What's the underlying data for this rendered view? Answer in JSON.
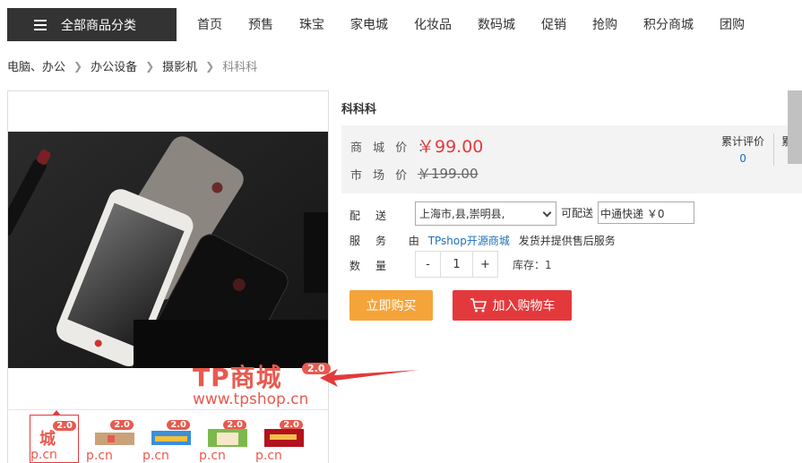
{
  "nav": {
    "category_button": "全部商品分类",
    "items": [
      "首页",
      "预售",
      "珠宝",
      "家电城",
      "化妆品",
      "数码城",
      "促销",
      "抢购",
      "积分商城",
      "团购"
    ]
  },
  "breadcrumb": [
    "电脑、办公",
    "办公设备",
    "摄影机",
    "科科科"
  ],
  "gallery": {
    "watermark_title": "TP商城",
    "watermark_badge": "2.0",
    "watermark_url": "www.tpshop.cn",
    "thumb_badge": "2.0",
    "thumb_url": "p.cn"
  },
  "product": {
    "title": "科科科",
    "mall_price_label": "商 城 价 ：",
    "mall_price": "￥99.00",
    "market_price_label": "市 场 价 ：",
    "market_price": "￥199.00",
    "review_label": "累计评价",
    "review_count": "0",
    "cut_text": "累"
  },
  "shipping": {
    "label": "配送",
    "region": "上海市,县,崇明县,",
    "can_ship": "可配送",
    "express": "中通快递 ￥0"
  },
  "service": {
    "label": "服务",
    "prefix": "由",
    "shop": "TPshop开源商城",
    "suffix": "发货并提供售后服务"
  },
  "quantity": {
    "label": "数量",
    "minus": "-",
    "value": "1",
    "plus": "+",
    "stock": "库存：1"
  },
  "buttons": {
    "buy_now": "立即购买",
    "add_cart": "加入购物车"
  },
  "colors": {
    "accent_red": "#e4393c",
    "buy_orange": "#f5a43a",
    "link_blue": "#1e6fb9"
  }
}
